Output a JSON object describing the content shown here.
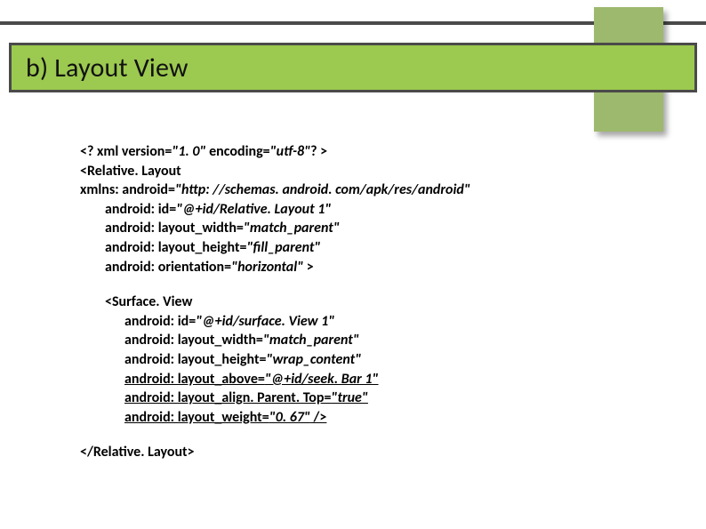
{
  "title": "b) Layout View",
  "code": {
    "l1_a": "<? xml version=",
    "l1_b": "\"1. 0\"",
    "l1_c": " encoding=",
    "l1_d": "\"utf-8\"",
    "l1_e": "? >",
    "l2": "<Relative. Layout",
    "l3_a": "xmlns: android=",
    "l3_b": "\"http: //schemas. android. com/apk/res/android\"",
    "l4_a": "android: id=",
    "l4_b": "\"@+id/Relative. Layout 1\"",
    "l5_a": "android: layout_width=",
    "l5_b": "\"match_parent\"",
    "l6_a": "android: layout_height=",
    "l6_b": "\"fill_parent\"",
    "l7_a": "android: orientation=",
    "l7_b": "\"horizontal\"",
    "l7_c": " >",
    "l8": "<Surface. View",
    "l9_a": "android: id=",
    "l9_b": "\"@+id/surface. View 1\"",
    "l10_a": "android: layout_width=",
    "l10_b": "\"match_parent\"",
    "l11_a": "android: layout_height=",
    "l11_b": "\"wrap_content\"",
    "l12_a": "android: layout_above=",
    "l12_b": "\"@+id/seek. Bar 1\"",
    "l13_a": "android: layout_align. Parent. Top=",
    "l13_b": "\"true\"",
    "l14_a": "android: layout_weight=",
    "l14_b": "\"0. 67\"",
    "l14_c": " />",
    "l15": "</Relative. Layout>"
  }
}
